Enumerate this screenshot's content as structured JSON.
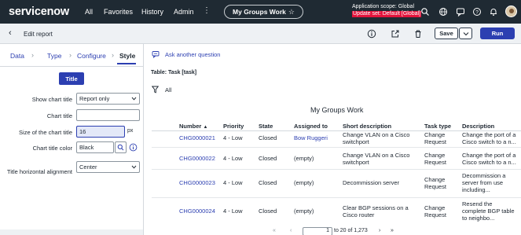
{
  "topnav": {
    "logo": "servicenow",
    "items": [
      "All",
      "Favorites",
      "History",
      "Admin"
    ],
    "more": "⋮",
    "workspace_pill": "My Groups Work",
    "star": "☆",
    "app_scope": "Application scope: Global",
    "update_set": "Update set: Default [Global]"
  },
  "header": {
    "back": "‹",
    "title": "Edit report",
    "save_label": "Save",
    "save_caret": "⌄",
    "run_label": "Run"
  },
  "steps": {
    "items": [
      "Data",
      "Type",
      "Configure",
      "Style"
    ],
    "arrow": "›",
    "active": "Style"
  },
  "style_panel": {
    "section_button": "Title",
    "show_chart_title": {
      "label": "Show chart title",
      "value": "Report only"
    },
    "chart_title": {
      "label": "Chart title",
      "value": ""
    },
    "chart_title_size": {
      "label": "Size of the chart title",
      "value": "16",
      "unit": "px"
    },
    "chart_title_color": {
      "label": "Chart title color",
      "value": "Black"
    },
    "title_alignment": {
      "label": "Title horizontal alignment",
      "value": "Center"
    }
  },
  "report": {
    "ask_link": "Ask another question",
    "table_label": "Table: Task [task]",
    "filter": "All",
    "title": "My Groups Work",
    "columns": [
      "Number",
      "Priority",
      "State",
      "Assigned to",
      "Short description",
      "Task type",
      "Description"
    ],
    "sort_indicator": "▲",
    "rows": [
      {
        "number": "CHG0000021",
        "priority": "4 - Low",
        "state": "Closed",
        "assigned": "Bow Ruggeri",
        "short": [
          "Change VLAN on a Cisco",
          "switchport"
        ],
        "type": [
          "Change",
          "Request"
        ],
        "desc": [
          "Change the port of a",
          "Cisco switch to a n..."
        ]
      },
      {
        "number": "CHG0000022",
        "priority": "4 - Low",
        "state": "Closed",
        "assigned": "(empty)",
        "short": [
          "Change VLAN on a Cisco",
          "switchport"
        ],
        "type": [
          "Change",
          "Request"
        ],
        "desc": [
          "Change the port of a",
          "Cisco switch to a n..."
        ]
      },
      {
        "number": "CHG0000023",
        "priority": "4 - Low",
        "state": "Closed",
        "assigned": "(empty)",
        "short": [
          "Decommission server",
          ""
        ],
        "type": [
          "Change",
          "Request"
        ],
        "desc": [
          "Decommission a",
          "server from use",
          "including..."
        ]
      },
      {
        "number": "CHG0000024",
        "priority": "4 - Low",
        "state": "Closed",
        "assigned": "(empty)",
        "short": [
          "Clear BGP sessions on a",
          "Cisco router"
        ],
        "type": [
          "Change",
          "Request"
        ],
        "desc": [
          "Resend the",
          "complete BGP table",
          "to neighbo..."
        ]
      }
    ],
    "pager": {
      "first": "«",
      "prev": "‹",
      "current": "1",
      "range": "to 20 of 1,273",
      "next": "›",
      "last": "»"
    }
  },
  "colors": {
    "topbar": "#1f2a33",
    "accent": "#2c3fb1",
    "update_set_bg": "#e3143c"
  }
}
